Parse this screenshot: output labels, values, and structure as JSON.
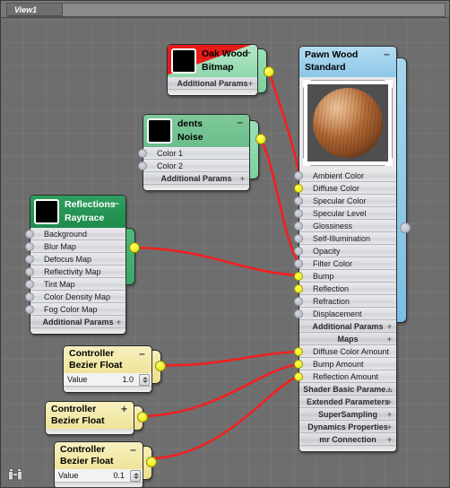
{
  "window": {
    "tab_label": "View1"
  },
  "status": {
    "tool_icon": "binoculars-icon"
  },
  "nodes": [
    {
      "id": "oak-wood-bitmap",
      "title": "Oak Wood",
      "subtitle": "Bitmap",
      "collapse_glyph": "–",
      "thumbnail": "wood-bitmap-thumbnail",
      "error_flag": true,
      "rollups": [
        {
          "label": "Additional Params",
          "glyph": "+"
        }
      ],
      "output_socket": "connected"
    },
    {
      "id": "dents-noise",
      "title": "dents",
      "subtitle": "Noise",
      "collapse_glyph": "–",
      "thumbnail": "noise-thumbnail",
      "params": [
        {
          "label": "Color 1",
          "socket": "open"
        },
        {
          "label": "Color 2",
          "socket": "open"
        }
      ],
      "rollups": [
        {
          "label": "Additional Params",
          "glyph": "+"
        }
      ],
      "output_socket": "connected"
    },
    {
      "id": "reflections-raytrace",
      "title": "Reflections",
      "subtitle": "Raytrace",
      "collapse_glyph": "–",
      "thumbnail": "black-thumbnail",
      "params": [
        {
          "label": "Background",
          "socket": "open"
        },
        {
          "label": "Blur Map",
          "socket": "open"
        },
        {
          "label": "Defocus Map",
          "socket": "open"
        },
        {
          "label": "Reflectivity Map",
          "socket": "open"
        },
        {
          "label": "Tint Map",
          "socket": "open"
        },
        {
          "label": "Color Density Map",
          "socket": "open"
        },
        {
          "label": "Fog Color Map",
          "socket": "open"
        }
      ],
      "rollups": [
        {
          "label": "Additional Params",
          "glyph": "+"
        }
      ],
      "output_socket": "connected"
    },
    {
      "id": "pawn-wood-standard",
      "title": "Pawn Wood",
      "subtitle": "Standard",
      "collapse_glyph": "–",
      "preview": "wood-sphere-preview",
      "params": [
        {
          "label": "Ambient Color",
          "socket": "open"
        },
        {
          "label": "Diffuse Color",
          "socket": "connected"
        },
        {
          "label": "Specular Color",
          "socket": "open"
        },
        {
          "label": "Specular Level",
          "socket": "open"
        },
        {
          "label": "Glossiness",
          "socket": "open"
        },
        {
          "label": "Self-Illumination",
          "socket": "open"
        },
        {
          "label": "Opacity",
          "socket": "open"
        },
        {
          "label": "Filter Color",
          "socket": "open"
        },
        {
          "label": "Bump",
          "socket": "connected"
        },
        {
          "label": "Reflection",
          "socket": "connected"
        },
        {
          "label": "Refraction",
          "socket": "open"
        },
        {
          "label": "Displacement",
          "socket": "open"
        }
      ],
      "rollups_mid": [
        {
          "label": "Additional Params",
          "glyph": "+"
        },
        {
          "label": "Maps",
          "glyph": "+"
        }
      ],
      "amount_params": [
        {
          "label": "Diffuse Color Amount",
          "socket": "connected"
        },
        {
          "label": "Bump Amount",
          "socket": "connected"
        },
        {
          "label": "Reflection Amount",
          "socket": "connected"
        }
      ],
      "rollups_bottom": [
        {
          "label": "Shader Basic Parame...",
          "glyph": "+"
        },
        {
          "label": "Extended Parameters",
          "glyph": "+"
        },
        {
          "label": "SuperSampling",
          "glyph": "+"
        },
        {
          "label": "Dynamics Properties",
          "glyph": "+"
        },
        {
          "label": "mr Connection",
          "glyph": "+"
        }
      ],
      "output_socket": "open"
    },
    {
      "id": "controller-bezier-float-1",
      "title": "Controller",
      "subtitle": "Bezier Float",
      "collapse_glyph": "–",
      "value_label": "Value",
      "value": "1.0",
      "output_socket": "connected"
    },
    {
      "id": "controller-bezier-float-2",
      "title": "Controller",
      "subtitle": "Bezier Float",
      "collapse_glyph": "+",
      "collapsed": true,
      "output_socket": "connected"
    },
    {
      "id": "controller-bezier-float-3",
      "title": "Controller",
      "subtitle": "Bezier Float",
      "collapse_glyph": "–",
      "value_label": "Value",
      "value": "0.1",
      "output_socket": "connected"
    }
  ],
  "colors": {
    "canvas_background": "#6e6e6e",
    "wire": "#f22020",
    "socket_connected": "#ffff00",
    "socket_open": "#b8bcc4",
    "map_node_header": "#8fd8ab",
    "material_node_header": "#8cc7e8",
    "controller_node_header": "#efe49a",
    "raytrace_node_header": "#1f8c4e",
    "error_flag": "#e81b1b"
  }
}
